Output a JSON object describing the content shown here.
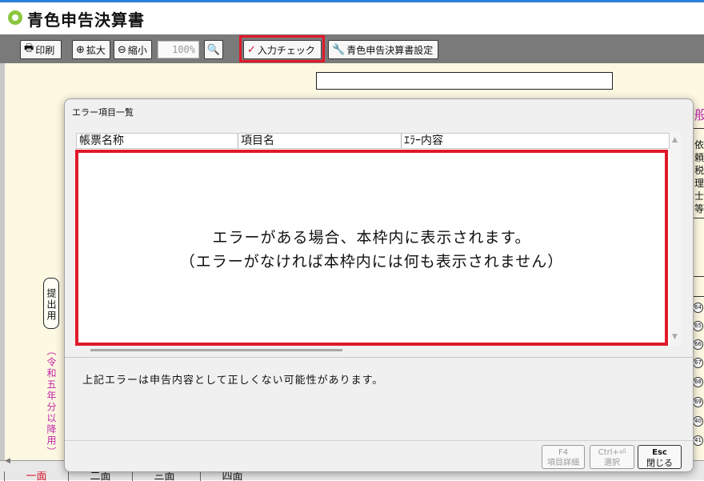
{
  "window": {
    "title": "青色申告決算書"
  },
  "toolbar": {
    "print_label": "印刷",
    "zoom_in_label": "拡大",
    "zoom_out_label": "縮小",
    "zoom_value": "100%",
    "input_check_label": "入力チェック",
    "settings_label": "青色申告決算書設定"
  },
  "form": {
    "submission_label": "提出用",
    "reiwa_label": "（令和五年分以降用）",
    "right_chars": [
      "依",
      "頼",
      "税",
      "理",
      "士",
      "等"
    ],
    "right_heading": "般",
    "right_numbers": [
      "64",
      "65",
      "66",
      "67",
      "68",
      "69",
      "40",
      "41"
    ]
  },
  "dialog": {
    "title": "エラー項目一覧",
    "columns": [
      "帳票名称",
      "項目名",
      "ｴﾗｰ内容"
    ],
    "message_line1": "エラーがある場合、本枠内に表示されます。",
    "message_line2": "（エラーがなければ本枠内には何も表示されません）",
    "note": "上記エラーは申告内容として正しくない可能性があります。",
    "buttons": {
      "detail_key": "F4",
      "detail_label": "項目詳細",
      "select_key": "Ctrl+⏎",
      "select_label": "選択",
      "close_key": "Esc",
      "close_label": "閉じる"
    }
  },
  "tabs": [
    "一面",
    "二面",
    "三面",
    "四面"
  ],
  "colors": {
    "accent_red": "#e0192a",
    "toolbar_gray": "#7a7a7a",
    "form_bg": "#fdf8e2",
    "purple": "#c026a8"
  }
}
